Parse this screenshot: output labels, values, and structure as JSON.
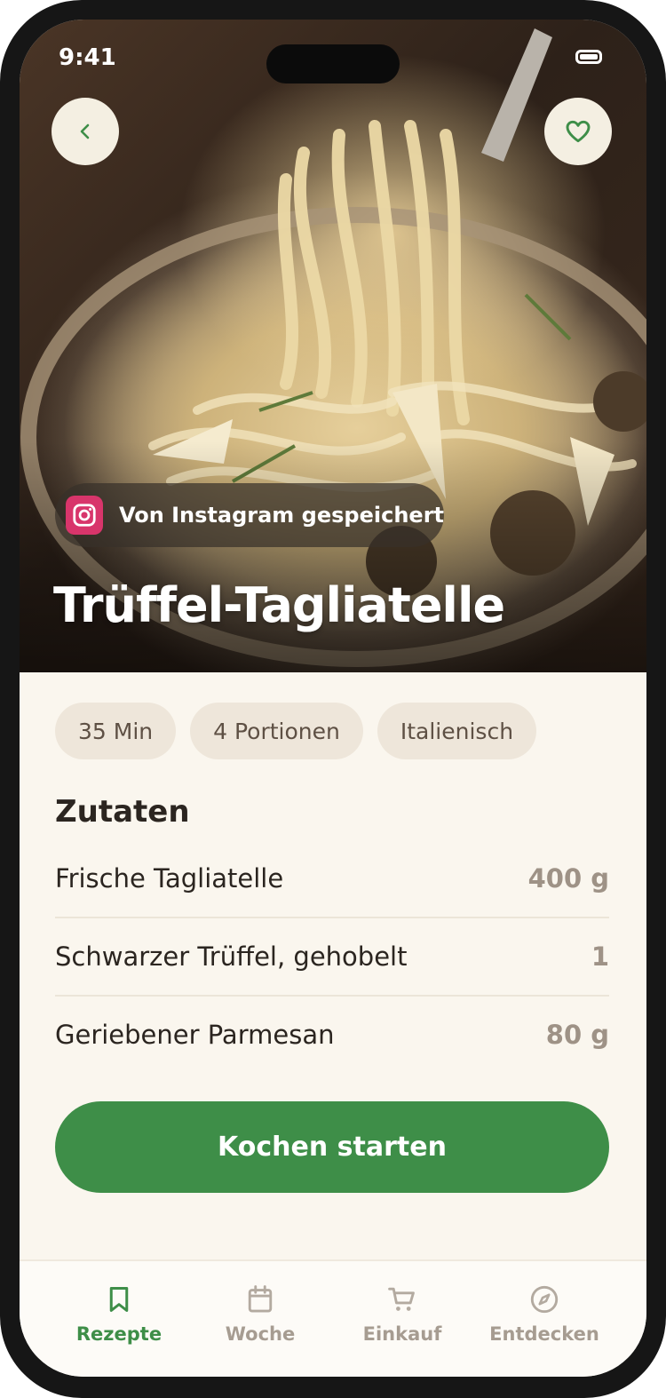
{
  "status_bar": {
    "time": "9:41"
  },
  "hero": {
    "source_badge": "Von Instagram gespeichert",
    "title": "Trüffel-Tagliatelle",
    "back_icon": "chevron-left-icon",
    "favorite_icon": "heart-icon",
    "source_icon": "instagram-icon"
  },
  "chips": [
    "35 Min",
    "4 Portionen",
    "Italienisch"
  ],
  "ingredients": {
    "heading": "Zutaten",
    "items": [
      {
        "name": "Frische Tagliatelle",
        "qty": "400 g"
      },
      {
        "name": "Schwarzer Trüffel, gehobelt",
        "qty": "1"
      },
      {
        "name": "Geriebener Parmesan",
        "qty": "80 g"
      }
    ]
  },
  "cta": {
    "label": "Kochen starten"
  },
  "tabs": [
    {
      "label": "Rezepte",
      "icon": "bookmark-icon",
      "active": true
    },
    {
      "label": "Woche",
      "icon": "calendar-icon",
      "active": false
    },
    {
      "label": "Einkauf",
      "icon": "cart-icon",
      "active": false
    },
    {
      "label": "Entdecken",
      "icon": "compass-icon",
      "active": false
    }
  ],
  "colors": {
    "accent": "#3e8e48",
    "background": "#faf6ee",
    "chip": "#eee6da",
    "muted": "#a69c91",
    "instagram": "#d8356b"
  }
}
